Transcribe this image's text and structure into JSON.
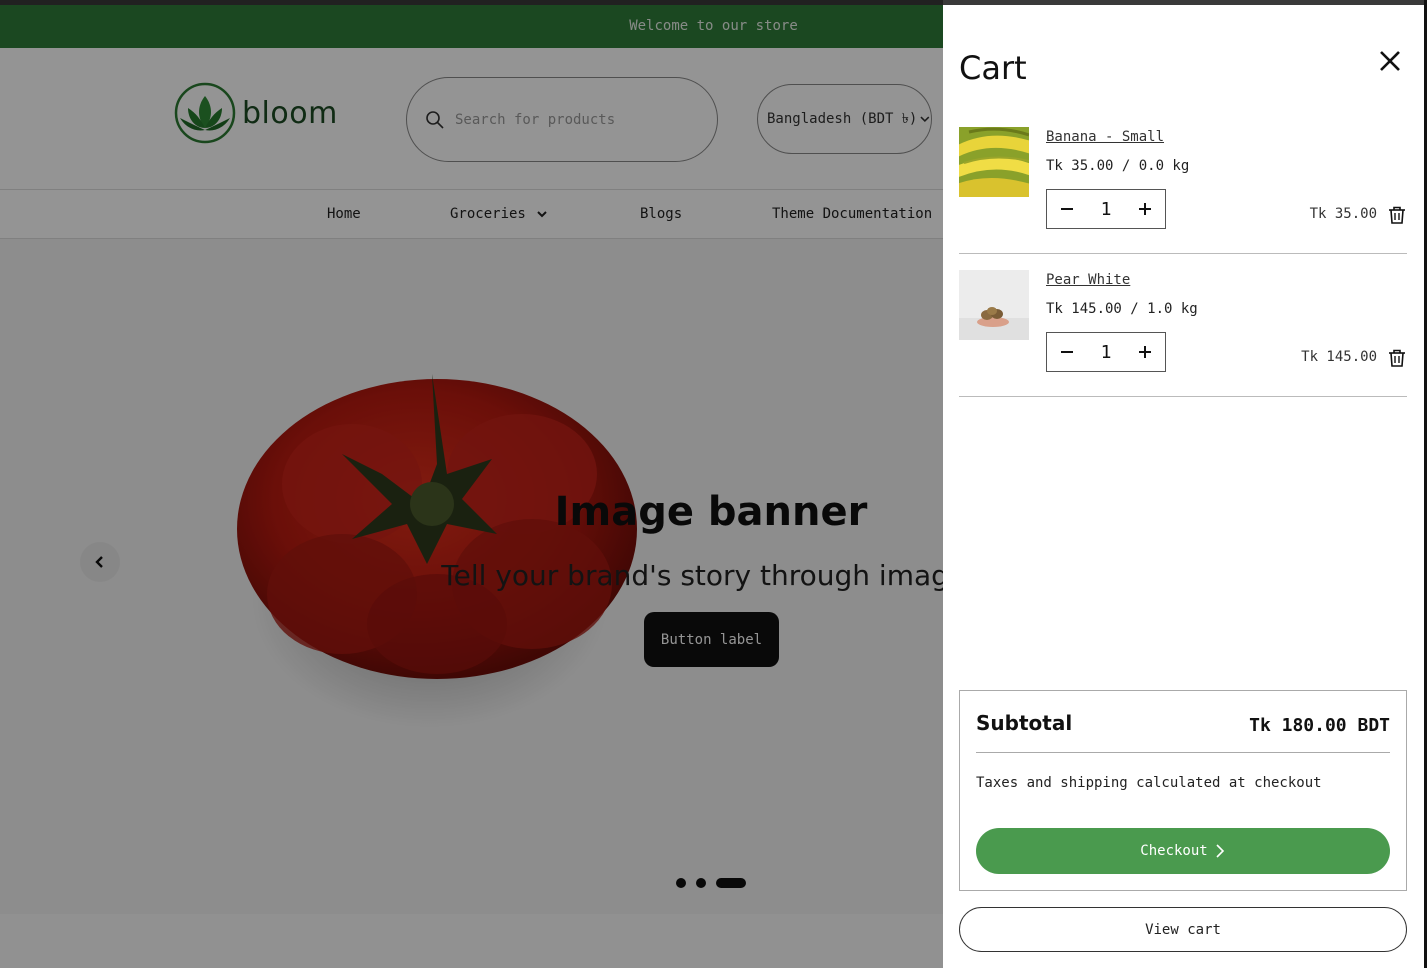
{
  "announcement": "Welcome to our store",
  "header": {
    "logo_text": "bloom",
    "search_placeholder": "Search for products",
    "country_selector": "Bangladesh (BDT ৳)"
  },
  "nav": [
    "Home",
    "Groceries",
    "Blogs",
    "Theme Documentation"
  ],
  "hero": {
    "title": "Image banner",
    "subtitle": "Tell your brand's story through images",
    "button_label": "Button label",
    "slides_count": 3,
    "active_slide": 3
  },
  "cart": {
    "title": "Cart",
    "items": [
      {
        "name": "Banana - Small",
        "unit_price": "Tk 35.00 / 0.0 kg",
        "quantity": "1",
        "line_total": "Tk 35.00"
      },
      {
        "name": "Pear White",
        "unit_price": "Tk 145.00 / 1.0 kg",
        "quantity": "1",
        "line_total": "Tk 145.00"
      }
    ],
    "subtotal_label": "Subtotal",
    "subtotal_value": "Tk 180.00 BDT",
    "tax_note": "Taxes and shipping calculated at checkout",
    "checkout_label": "Checkout",
    "view_cart_label": "View cart"
  },
  "colors": {
    "brand_green": "#2f7d3a",
    "checkout_green": "#4a9a4e",
    "overlay": "rgba(0,0,0,0.42)"
  },
  "icons": [
    "search-icon",
    "chevron-down-icon",
    "chevron-left-icon",
    "close-icon",
    "minus-icon",
    "plus-icon",
    "trash-icon",
    "chevron-right-icon"
  ]
}
